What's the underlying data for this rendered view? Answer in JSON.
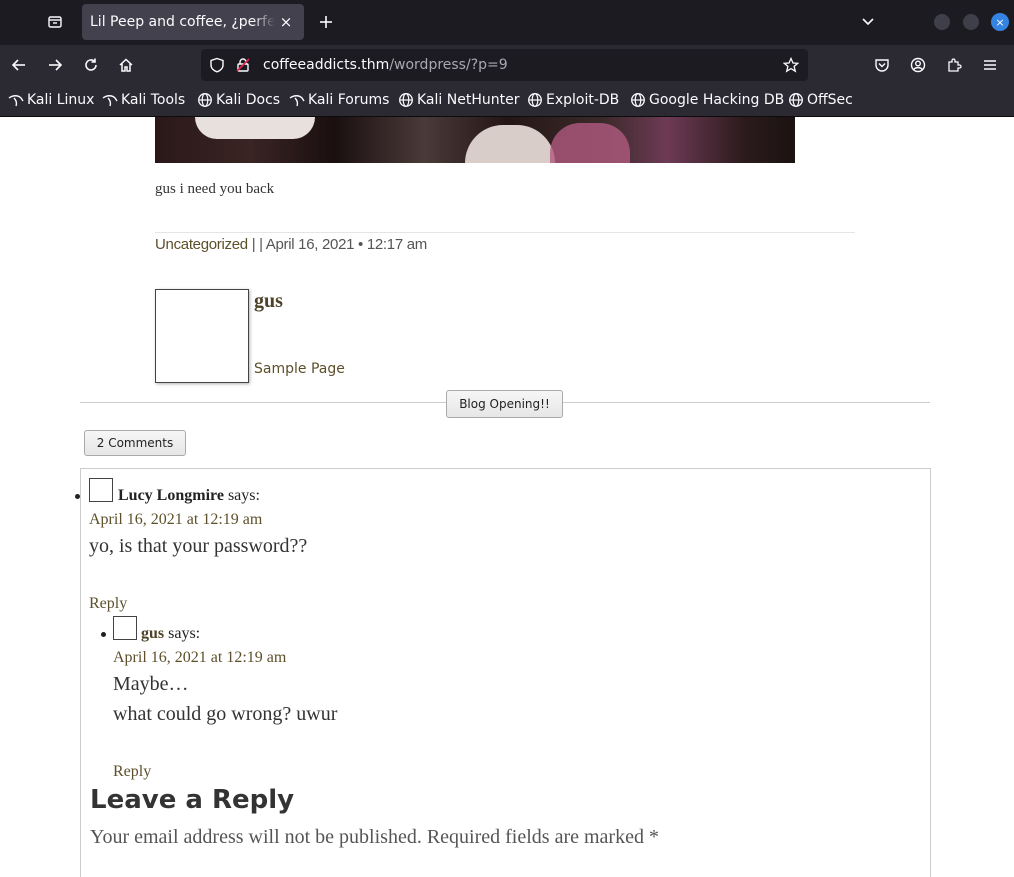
{
  "browser": {
    "tab_title": "Lil Peep and coffee, ¿perfect combo?",
    "tab_close_glyph": "×",
    "new_tab_glyph": "+",
    "url_host": "coffeeaddicts.thm",
    "url_path": "/wordpress/?p=9",
    "win_close_glyph": "×",
    "icons": [
      "tab-list-icon",
      "close-icon",
      "plus-icon",
      "chevron-down-icon",
      "back-arrow-icon",
      "forward-arrow-icon",
      "reload-icon",
      "home-icon",
      "shield-icon",
      "lock-warning-icon",
      "star-icon",
      "pocket-icon",
      "account-icon",
      "extensions-icon",
      "menu-icon",
      "kali-dragon-icon",
      "globe-icon"
    ]
  },
  "bookmarks": [
    {
      "label": "Kali Linux",
      "icon": "kali-dragon-icon"
    },
    {
      "label": "Kali Tools",
      "icon": "kali-dragon-icon"
    },
    {
      "label": "Kali Docs",
      "icon": "globe-icon"
    },
    {
      "label": "Kali Forums",
      "icon": "kali-dragon-icon"
    },
    {
      "label": "Kali NetHunter",
      "icon": "globe-icon"
    },
    {
      "label": "Exploit-DB",
      "icon": "globe-icon"
    },
    {
      "label": "Google Hacking DB",
      "icon": "globe-icon"
    },
    {
      "label": "OffSec",
      "icon": "globe-icon"
    }
  ],
  "post": {
    "caption": "gus i need you back",
    "category": "Uncategorized",
    "meta_rest": " | | April 16, 2021 • 12:17 am",
    "author_name": "gus",
    "author_link": "Sample Page"
  },
  "post_nav": {
    "prev_label": "Blog Opening!!"
  },
  "comments": {
    "toggle_label": "2 Comments",
    "items": [
      {
        "author": "Lucy Longmire",
        "says": " says:",
        "date": "April 16, 2021 at 12:19 am",
        "lines": [
          "yo, is that your password??"
        ],
        "reply": "Reply"
      },
      {
        "author": "gus",
        "says": " says:",
        "date": "April 16, 2021 at 12:19 am",
        "lines": [
          "Maybe…",
          "what could go wrong? uwur"
        ],
        "reply": "Reply"
      }
    ]
  },
  "reply_form": {
    "title": "Leave a Reply",
    "notes": "Your email address will not be published. Required fields are marked *"
  },
  "colors": {
    "link": "#5d4f2a",
    "browser_chrome": "#2b2a33",
    "tab_bar": "#1c1b22",
    "close_accent": "#3584e4"
  }
}
